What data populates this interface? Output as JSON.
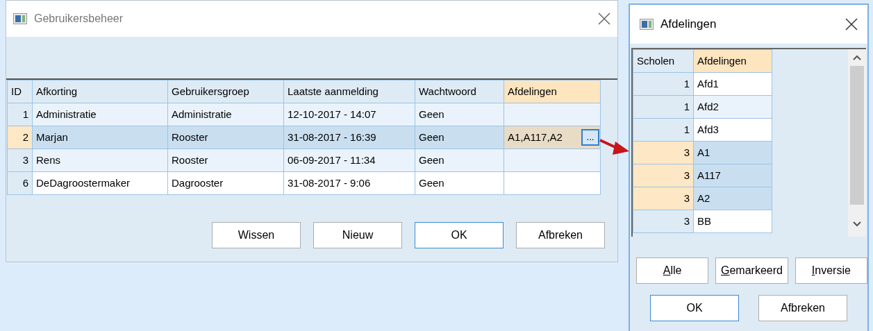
{
  "main_window": {
    "title": "Gebruikersbeheer",
    "table": {
      "columns": [
        {
          "label": "ID",
          "selected": false
        },
        {
          "label": "Afkorting",
          "selected": false
        },
        {
          "label": "Gebruikersgroep",
          "selected": false
        },
        {
          "label": "Laatste aanmelding",
          "selected": false
        },
        {
          "label": "Wachtwoord",
          "selected": false
        },
        {
          "label": "Afdelingen",
          "selected": true
        }
      ],
      "rows": [
        {
          "selected": false,
          "cells": [
            "1",
            "Administratie",
            "Administratie",
            "12-10-2017 - 14:07",
            "Geen",
            ""
          ]
        },
        {
          "selected": true,
          "cells": [
            "2",
            "Marjan",
            "Rooster",
            "31-08-2017 - 16:39",
            "Geen",
            "A1,A117,A2"
          ],
          "editor_button": "..."
        },
        {
          "selected": false,
          "cells": [
            "3",
            "Rens",
            "Rooster",
            "06-09-2017 - 11:34",
            "Geen",
            ""
          ]
        },
        {
          "selected": false,
          "cells": [
            "6",
            "DeDagroostermaker",
            "Dagrooster",
            "31-08-2017 - 9:06",
            "Geen",
            ""
          ]
        }
      ]
    },
    "buttons": [
      {
        "label": "Wissen",
        "default": false
      },
      {
        "label": "Nieuw",
        "default": false
      },
      {
        "label": "OK",
        "default": true
      },
      {
        "label": "Afbreken",
        "default": false
      }
    ]
  },
  "popup_window": {
    "title": "Afdelingen",
    "table": {
      "columns": [
        {
          "label": "Scholen",
          "selected": false
        },
        {
          "label": "Afdelingen",
          "selected": true
        }
      ],
      "rows": [
        {
          "selected": false,
          "cells": [
            "1",
            "Afd1"
          ]
        },
        {
          "selected": false,
          "cells": [
            "1",
            "Afd2"
          ]
        },
        {
          "selected": false,
          "cells": [
            "1",
            "Afd3"
          ]
        },
        {
          "selected": true,
          "cells": [
            "3",
            "A1"
          ]
        },
        {
          "selected": true,
          "cells": [
            "3",
            "A117"
          ]
        },
        {
          "selected": true,
          "cells": [
            "3",
            "A2"
          ]
        },
        {
          "selected": false,
          "cells": [
            "3",
            "BB"
          ]
        }
      ]
    },
    "select_buttons": [
      {
        "label": "Alle",
        "mnemonic": true
      },
      {
        "label": "Gemarkeerd",
        "mnemonic": true
      },
      {
        "label": "Inversie",
        "mnemonic": true
      }
    ],
    "buttons": [
      {
        "label": "OK",
        "default": true
      },
      {
        "label": "Afbreken",
        "default": false
      }
    ]
  }
}
